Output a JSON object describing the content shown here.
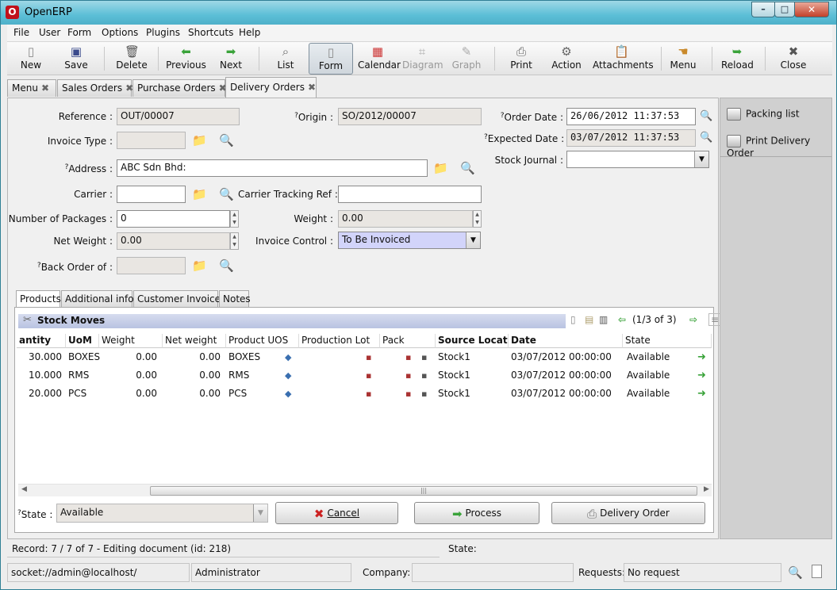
{
  "window": {
    "title": "OpenERP",
    "minimize": "–",
    "maximize": "□",
    "close": "✕"
  },
  "menu": [
    "File",
    "User",
    "Form",
    "Options",
    "Plugins",
    "Shortcuts",
    "Help"
  ],
  "toolbar": {
    "new": "New",
    "save": "Save",
    "delete": "Delete",
    "previous": "Previous",
    "next": "Next",
    "list": "List",
    "form": "Form",
    "calendar": "Calendar",
    "diagram": "Diagram",
    "graph": "Graph",
    "print": "Print",
    "action": "Action",
    "attachments": "Attachments",
    "menu": "Menu",
    "reload": "Reload",
    "close": "Close"
  },
  "tabs": [
    "Menu",
    "Sales Orders",
    "Purchase Orders",
    "Delivery Orders"
  ],
  "form": {
    "reference_label": "Reference :",
    "reference": "OUT/00007",
    "origin_label": "Origin :",
    "origin": "SO/2012/00007",
    "order_date_label": "Order Date :",
    "order_date": "26/06/2012 11:37:53",
    "invoice_type_label": "Invoice Type :",
    "expected_date_label": "Expected Date :",
    "expected_date": "03/07/2012 11:37:53",
    "address_label": "Address :",
    "address": "ABC Sdn Bhd:",
    "stock_journal_label": "Stock Journal :",
    "carrier_label": "Carrier :",
    "carrier_tracking_label": "Carrier Tracking Ref :",
    "packages_label": "Number of Packages :",
    "packages": "0",
    "weight_label": "Weight :",
    "weight": "0.00",
    "net_weight_label": "Net Weight :",
    "net_weight": "0.00",
    "invoice_control_label": "Invoice Control :",
    "invoice_control": "To Be Invoiced",
    "back_order_label": "Back Order of :",
    "help_mark": "?"
  },
  "notebook_tabs": [
    "Products",
    "Additional info",
    "Customer Invoices",
    "Notes"
  ],
  "stock_moves": {
    "title": "Stock Moves",
    "pager": "(1/3 of 3)",
    "columns": [
      "antity",
      "UoM",
      "Weight",
      "Net weight",
      "Product UOS",
      "Production Lot",
      "Pack",
      "Source Location",
      "Date",
      "State"
    ],
    "rows": [
      {
        "qty": "30.000",
        "uom": "BOXES",
        "weight": "0.00",
        "net": "0.00",
        "uos": "BOXES",
        "source": "Stock1",
        "date": "03/07/2012 00:00:00",
        "state": "Available"
      },
      {
        "qty": "10.000",
        "uom": "RMS",
        "weight": "0.00",
        "net": "0.00",
        "uos": "RMS",
        "source": "Stock1",
        "date": "03/07/2012 00:00:00",
        "state": "Available"
      },
      {
        "qty": "20.000",
        "uom": "PCS",
        "weight": "0.00",
        "net": "0.00",
        "uos": "PCS",
        "source": "Stock1",
        "date": "03/07/2012 00:00:00",
        "state": "Available"
      }
    ]
  },
  "footer": {
    "state_label": "State :",
    "state": "Available",
    "cancel": "Cancel",
    "process": "Process",
    "delivery_order": "Delivery Order"
  },
  "side": {
    "packing_list": "Packing list",
    "print_delivery": "Print Delivery Order"
  },
  "status": {
    "record": "Record: 7 / 7 of 7 - Editing document (id: 218)",
    "state_label": "State:",
    "socket": "socket://admin@localhost/",
    "user": "Administrator",
    "company_label": "Company:",
    "requests_label": "Requests:",
    "requests": "No request"
  },
  "colors": {
    "required_field": "#d2d4fa",
    "title_bar": "#5cbfd7",
    "section_header": "#c4cde6"
  }
}
